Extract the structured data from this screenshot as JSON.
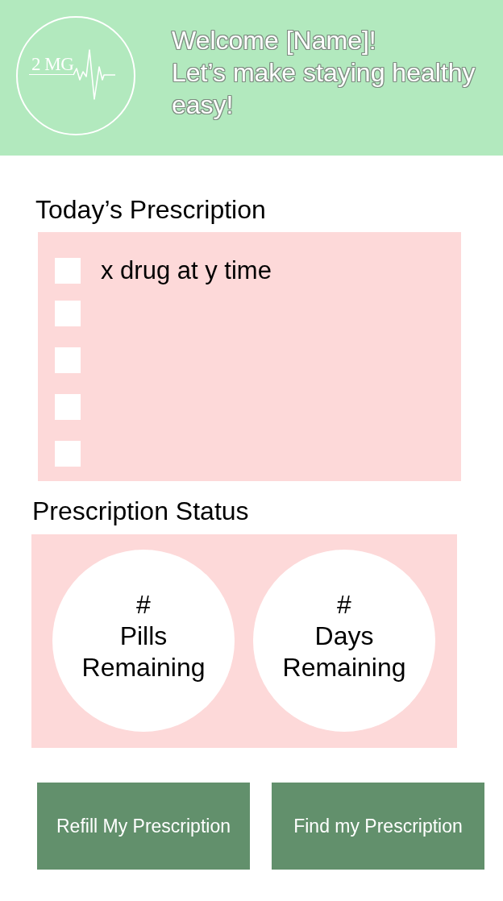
{
  "header": {
    "logo": {
      "text": "2 MG"
    },
    "greeting": "Welcome [Name]!",
    "tagline": "Let’s make staying healthy easy!"
  },
  "todays_prescription": {
    "title": "Today’s Prescription",
    "items": [
      {
        "label": "x drug at y time",
        "checked": false
      },
      {
        "checked": false
      },
      {
        "checked": false
      },
      {
        "checked": false
      },
      {
        "checked": false
      }
    ]
  },
  "prescription_status": {
    "title": "Prescription Status",
    "stats": [
      {
        "value": "#",
        "label": "Pills Remaining"
      },
      {
        "value": "#",
        "label": "Days Remaining"
      }
    ]
  },
  "buttons": [
    "Refill My Prescription",
    "Find my Prescription"
  ]
}
